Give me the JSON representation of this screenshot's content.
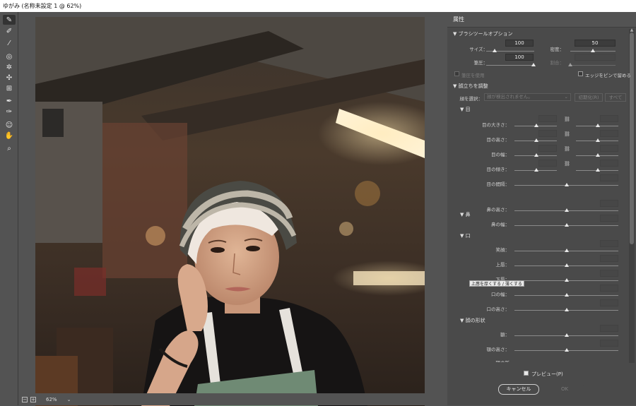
{
  "window": {
    "title": "ゆがみ (名称未設定 1 @ 62%)"
  },
  "toolbar": {
    "tools": [
      {
        "name": "forward-warp-tool-icon",
        "glyph": "✎",
        "active": true
      },
      {
        "name": "reconstruct-tool-icon",
        "glyph": "✐"
      },
      {
        "name": "smooth-tool-icon",
        "glyph": "⁄"
      },
      {
        "name": "twirl-tool-icon",
        "glyph": "◎"
      },
      {
        "name": "pucker-tool-icon",
        "glyph": "✲"
      },
      {
        "name": "bloat-tool-icon",
        "glyph": "✣"
      },
      {
        "name": "push-left-tool-icon",
        "glyph": "⊞"
      },
      {
        "name": "freeze-mask-tool-icon",
        "glyph": "✒"
      },
      {
        "name": "thaw-mask-tool-icon",
        "glyph": "✑"
      },
      {
        "name": "face-tool-icon",
        "glyph": "☺"
      },
      {
        "name": "hand-tool-icon",
        "glyph": "✋"
      },
      {
        "name": "zoom-tool-icon",
        "glyph": "⌕"
      }
    ]
  },
  "status": {
    "zoom_out": "−",
    "zoom_in": "+",
    "zoom": "62%",
    "chevron": "⌄"
  },
  "panel": {
    "title": "属性",
    "brush_section": "ブラシツールオプション",
    "size_label": "サイズ：",
    "size_value": "100",
    "density_label": "密度：",
    "density_value": "50",
    "pressure_label": "筆圧：",
    "pressure_value": "100",
    "rate_label": "割合：",
    "stylus_label": "筆圧を使用",
    "pin_edges_label": "エッジをピンで留める",
    "face_section": "顔立ちを調整",
    "face_select_label": "顔を選択：",
    "face_select_value": "顔が検出されません。",
    "reset_label": "初期化(R)",
    "all_label": "すべて",
    "eyes_section": "目",
    "eye_size": "目の大きさ：",
    "eye_height": "目の高さ：",
    "eye_width": "目の幅：",
    "eye_tilt": "目の傾き：",
    "eye_distance": "目の間隔：",
    "nose_section": "鼻",
    "nose_height": "鼻の高さ：",
    "nose_width": "鼻の幅：",
    "mouth_section": "口",
    "smile": "笑顔：",
    "upper_lip": "上唇：",
    "lower_lip": "下唇：",
    "mouth_width": "口の幅：",
    "mouth_height": "口の高さ：",
    "face_shape_section": "顔の形状",
    "forehead": "額：",
    "chin_height": "顎の高さ：",
    "jaw_partial": "顎の形",
    "tooltip": "上唇を厚くする / 薄くする",
    "preview_label": "プレビュー(P)",
    "cancel_label": "キャンセル",
    "ok_label": "OK"
  }
}
